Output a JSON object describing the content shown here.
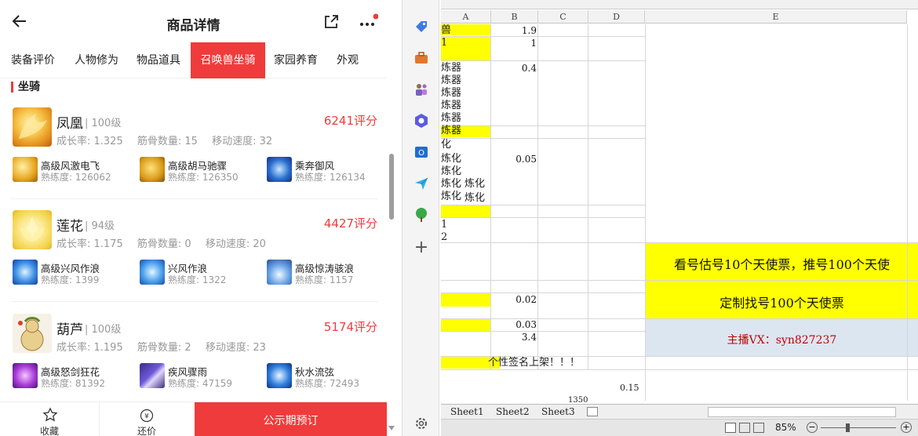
{
  "mobile": {
    "title": "商品详情",
    "tabs": [
      {
        "label": "装备评价"
      },
      {
        "label": "人物修为"
      },
      {
        "label": "物品道具"
      },
      {
        "label": "召唤兽坐骑"
      },
      {
        "label": "家园养育"
      },
      {
        "label": "外观"
      }
    ],
    "section_title": "坐骑",
    "mounts": [
      {
        "name": "凤凰",
        "level": "| 100级",
        "score": "6241评分",
        "growth": "成长率: 1.325",
        "bones": "筋骨数量: 15",
        "speed": "移动速度: 32",
        "skills": [
          {
            "name": "高级风激电飞",
            "prof": "熟练度: 126062"
          },
          {
            "name": "高级胡马驰骤",
            "prof": "熟练度: 126350"
          },
          {
            "name": "乘奔御风",
            "prof": "熟练度: 126134"
          }
        ]
      },
      {
        "name": "莲花",
        "level": "| 94级",
        "score": "4427评分",
        "growth": "成长率: 1.175",
        "bones": "筋骨数量: 0",
        "speed": "移动速度: 20",
        "skills": [
          {
            "name": "高级兴风作浪",
            "prof": "熟练度: 1399"
          },
          {
            "name": "兴风作浪",
            "prof": "熟练度: 1322"
          },
          {
            "name": "高级惊涛骇浪",
            "prof": "熟练度: 1157"
          }
        ]
      },
      {
        "name": "葫芦",
        "level": "| 100级",
        "score": "5174评分",
        "growth": "成长率: 1.195",
        "bones": "筋骨数量: 2",
        "speed": "移动速度: 23",
        "skills": [
          {
            "name": "高级怒剑狂花",
            "prof": "熟练度: 81392"
          },
          {
            "name": "疾风骤雨",
            "prof": "熟练度: 47159"
          },
          {
            "name": "秋水流弦",
            "prof": "熟练度: 72493"
          }
        ]
      }
    ],
    "bottom": {
      "favorite": "收藏",
      "bargain": "还价",
      "buy": "公示期预订"
    }
  },
  "sheet": {
    "columns": [
      "A",
      "B",
      "C",
      "D",
      "E"
    ],
    "a_column": [
      {
        "text": "兽"
      },
      {
        "text": "1"
      },
      {
        "text": "炼器"
      },
      {
        "text": "炼器"
      },
      {
        "text": "炼器"
      },
      {
        "text": "炼器"
      },
      {
        "text": "炼器"
      },
      {
        "text": "炼器"
      },
      {
        "text": "化"
      },
      {
        "text": "炼化"
      },
      {
        "text": "炼化"
      },
      {
        "text": "炼化"
      },
      {
        "text": "炼化"
      },
      {
        "text": "炼化"
      },
      {
        "text": "炼化"
      },
      {
        "text": "1"
      },
      {
        "text": "2"
      }
    ],
    "b_values": [
      "1.9",
      "1",
      "0.4",
      "0.05",
      "0.02",
      "0.03",
      "3.4"
    ],
    "e_banners": {
      "estimate": "看号估号10个天使票，推号100个天使",
      "custom": "定制找号100个天使票",
      "contact": "主播VX：syn827237"
    },
    "notice": "个性签名上架！！！",
    "c_value": "1350",
    "d_value": "0.15",
    "tabs": [
      "Sheet1",
      "Sheet2",
      "Sheet3"
    ],
    "zoom": "85%",
    "colors": {
      "yellow": "#ffff00",
      "contact_bg": "#dce6f1",
      "contact_text": "#c00000"
    }
  }
}
